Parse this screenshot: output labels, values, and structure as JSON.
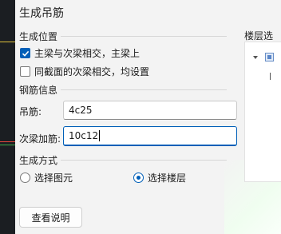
{
  "dialog": {
    "title": "生成吊筋",
    "position_group": {
      "title": "生成位置",
      "options": [
        {
          "label": "主梁与次梁相交，主梁上",
          "checked": true
        },
        {
          "label": "同截面的次梁相交，均设置",
          "checked": false
        }
      ]
    },
    "rebar_group": {
      "title": "钢筋信息",
      "hanger_label": "吊筋:",
      "hanger_value": "4c25",
      "secondary_label": "次梁加筋:",
      "secondary_value": "10c12"
    },
    "method_group": {
      "title": "生成方式",
      "options": [
        {
          "label": "选择图元",
          "selected": false
        },
        {
          "label": "选择楼层",
          "selected": true
        }
      ]
    },
    "help_button": "查看说明",
    "floor_panel": {
      "title": "楼层选择"
    }
  },
  "colors": {
    "accent": "#005fb8",
    "cad_background": "#1b1e22"
  }
}
